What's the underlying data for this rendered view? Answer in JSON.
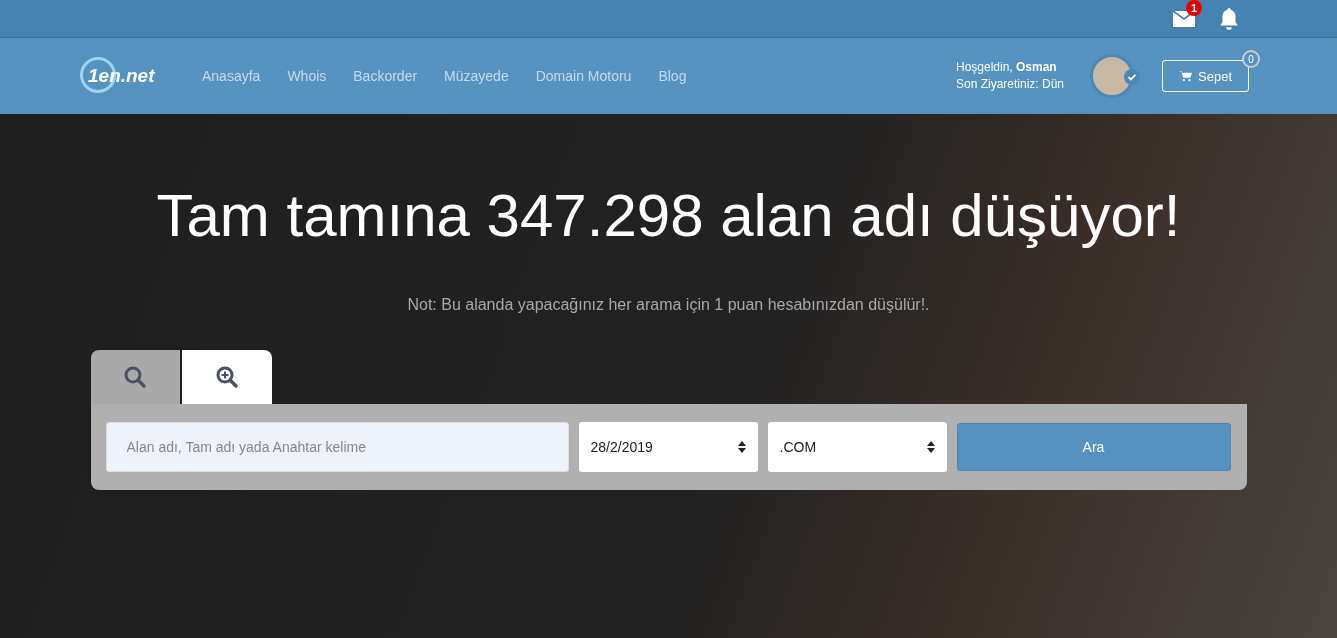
{
  "topbar": {
    "mail_badge": "1"
  },
  "header": {
    "logo": "1en.net",
    "nav": [
      {
        "label": "Anasayfa"
      },
      {
        "label": "Whois"
      },
      {
        "label": "Backorder"
      },
      {
        "label": "Müzayede"
      },
      {
        "label": "Domain Motoru"
      },
      {
        "label": "Blog"
      }
    ],
    "greeting": {
      "prefix": "Hoşgeldin,",
      "name": "Osman",
      "last_visit": "Son Ziyaretiniz: Dün"
    },
    "cart": {
      "label": "Sepet",
      "count": "0"
    }
  },
  "hero": {
    "title": "Tam tamına 347.298 alan adı düşüyor!",
    "note": "Not: Bu alanda yapacağınız her arama için 1 puan hesabınızdan düşülür!.",
    "tabs": [
      {
        "kind": "search",
        "selected": false
      },
      {
        "kind": "zoom",
        "selected": true
      }
    ],
    "search": {
      "placeholder": "Alan adı, Tam adı yada Anahtar kelime",
      "date": "28/2/2019",
      "tld": ".COM",
      "button": "Ara"
    }
  }
}
